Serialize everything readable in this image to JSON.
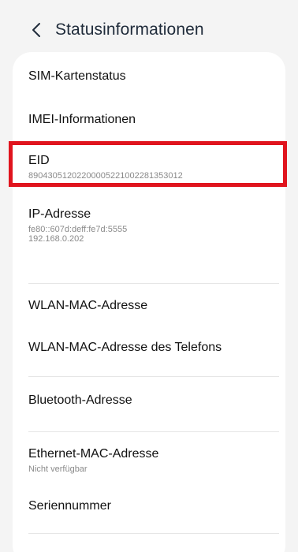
{
  "header": {
    "back_icon": "chevron-left-icon",
    "title": "Statusinformationen"
  },
  "items": [
    {
      "label": "SIM-Kartenstatus"
    },
    {
      "label": "IMEI-Informationen"
    },
    {
      "label": "EID",
      "value": "89043051202200005221002281353012"
    },
    {
      "label": "IP-Adresse",
      "value_lines": [
        "fe80::607d:deff:fe7d:5555",
        "192.168.0.202"
      ]
    },
    {
      "label": "WLAN-MAC-Adresse"
    },
    {
      "label": "WLAN-MAC-Adresse des Telefons"
    },
    {
      "label": "Bluetooth-Adresse"
    },
    {
      "label": "Ethernet-MAC-Adresse",
      "value": "Nicht verfügbar"
    },
    {
      "label": "Seriennummer"
    }
  ],
  "colors": {
    "highlight_border": "#e0141e",
    "secondary_text": "#8a8a8a",
    "background": "#f4f4f4",
    "card": "#ffffff"
  }
}
